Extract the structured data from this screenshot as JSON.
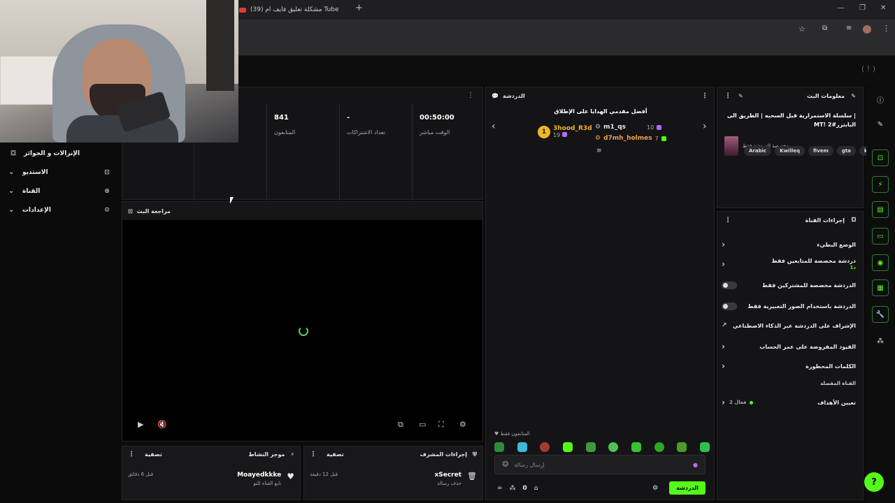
{
  "browser": {
    "tab_title": "مشكلة تعليق فايف ام (39) Tube",
    "new_tab": "+",
    "win_min": "—",
    "win_max": "❐",
    "win_close": "✕"
  },
  "nav": {
    "items": [
      {
        "label": "الإنزالات و الجوائز",
        "icon": "gift-icon"
      },
      {
        "label": "الاستديو",
        "icon": "studio-icon"
      },
      {
        "label": "القناة",
        "icon": "channel-icon"
      },
      {
        "label": "الإعدادات",
        "icon": "gear-icon"
      }
    ]
  },
  "stats": {
    "items": [
      {
        "value": "00:50:00",
        "label": "الوقت مباشر"
      },
      {
        "value": "-",
        "label": "تعداد الاشتراكات"
      },
      {
        "value": "841",
        "label": "المتابعون"
      }
    ]
  },
  "preview": {
    "title": "مراجعة البث"
  },
  "activity": {
    "title": "موجز النشاط",
    "filter": "تصفية",
    "name": "Moayedkkke",
    "sub": "تابع القناة للتو",
    "time": "قبل 6 دقائق"
  },
  "modactions": {
    "title": "إجراءات المشرف",
    "filter": "تصفية",
    "name": "xSecret",
    "sub": "حذف رسالة",
    "time": "قبل 12 دقيقة"
  },
  "chat": {
    "title": "الدردشة",
    "gifters_title": "أفضل مقدمي الهدايا على الإطلاق",
    "gifters": [
      {
        "rank": "1",
        "name": "3hood_R3d",
        "count": "19"
      },
      {
        "name": "m1_qs",
        "count": "10"
      },
      {
        "name": "d7mh_holmes",
        "count": "7"
      }
    ],
    "followers_only": "المتابعون فقط",
    "input_placeholder": "إرسال رسالة",
    "count": "0",
    "send_label": "الدردشة"
  },
  "info": {
    "header": "معلومات البث",
    "title": "سلسلة الاستمرارية قبل السحبه | الطريق الى | MT! البابتزر#2",
    "category": "مخصصة للدردشة فقط",
    "tags": [
      "Arabic",
      "Kwilleq",
      "fivem",
      "gta",
      "k"
    ]
  },
  "actions": {
    "header": "إجراءات القناة",
    "slow_mode": "الوضع البطيء",
    "followers_chat": "دردشة مخصصة للمتابعين فقط",
    "followers_chat_sub": "1د",
    "subs_chat": "الدردشة مخصصة للمشتركين فقط",
    "emote_chat": "الدردشة باستخدام الصور التعبيرية فقط",
    "ai_mod": "الإشراف على الدردشة عبر الذكاء الاصطناعي",
    "age_limits": "القيود المفروضة على عمر الحساب",
    "banned_words": "الكلمات المحظورة",
    "section_fav": "القناة المفضلة",
    "goals": "تعيين الأهداف",
    "goals_sub": "فعال 2"
  },
  "colors": {
    "accent": "#53fc18",
    "gold": "#f0b429"
  }
}
